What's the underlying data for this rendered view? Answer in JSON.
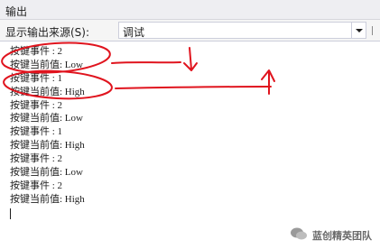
{
  "window": {
    "title": "输出"
  },
  "toolbar": {
    "source_label": "显示输出来源(S):",
    "source_value": "调试"
  },
  "output_lines": [
    "按键事件 : 2",
    "按键当前值: Low",
    "按键事件 : 1",
    "按键当前值: High",
    "按键事件 : 2",
    "按键当前值: Low",
    "按键事件 : 1",
    "按键当前值: High",
    "按键事件 : 2",
    "按键当前值: Low",
    "按键事件 : 2",
    "按键当前值: High"
  ],
  "annotation_color": "#e0141e",
  "watermark": {
    "text": "蓝创精英团队"
  }
}
